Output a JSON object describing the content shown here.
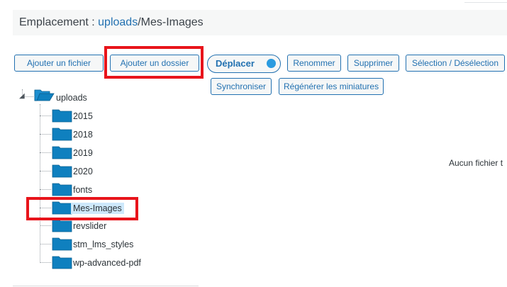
{
  "location": {
    "prefix": "Emplacement : ",
    "root_link": "uploads",
    "path_rest": "/Mes-Images"
  },
  "toolbar": {
    "add_file": "Ajouter un fichier",
    "add_folder": "Ajouter un dossier",
    "move": "Déplacer",
    "rename": "Renommer",
    "delete": "Supprimer",
    "select_toggle": "Sélection / Désélection",
    "sync": "Synchroniser",
    "regen_thumbs": "Régénérer les miniatures"
  },
  "tree": {
    "root": "uploads",
    "children": [
      "2015",
      "2018",
      "2019",
      "2020",
      "fonts",
      "Mes-Images",
      "revslider",
      "stm_lms_styles",
      "wp-advanced-pdf"
    ],
    "selected": "Mes-Images"
  },
  "content": {
    "empty_message": "Aucun fichier t"
  },
  "colors": {
    "accent": "#2271b1",
    "folder": "#0f80bf",
    "highlight": "#e8141b",
    "selected_bg": "#cde8fb"
  }
}
